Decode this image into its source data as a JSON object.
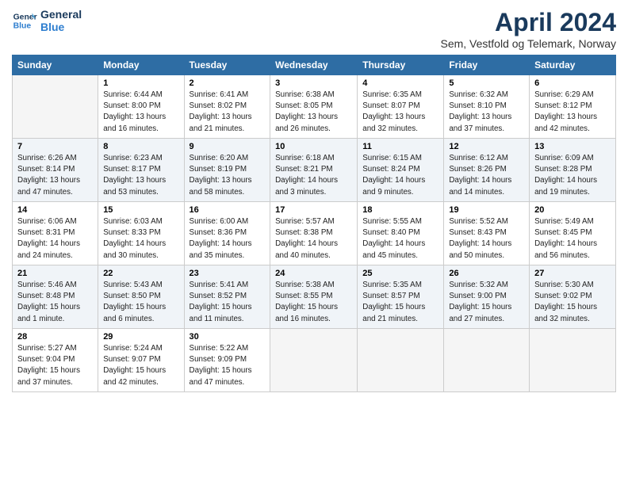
{
  "header": {
    "logo_line1": "General",
    "logo_line2": "Blue",
    "title": "April 2024",
    "subtitle": "Sem, Vestfold og Telemark, Norway"
  },
  "weekdays": [
    "Sunday",
    "Monday",
    "Tuesday",
    "Wednesday",
    "Thursday",
    "Friday",
    "Saturday"
  ],
  "weeks": [
    [
      {
        "day": "",
        "info": ""
      },
      {
        "day": "1",
        "info": "Sunrise: 6:44 AM\nSunset: 8:00 PM\nDaylight: 13 hours\nand 16 minutes."
      },
      {
        "day": "2",
        "info": "Sunrise: 6:41 AM\nSunset: 8:02 PM\nDaylight: 13 hours\nand 21 minutes."
      },
      {
        "day": "3",
        "info": "Sunrise: 6:38 AM\nSunset: 8:05 PM\nDaylight: 13 hours\nand 26 minutes."
      },
      {
        "day": "4",
        "info": "Sunrise: 6:35 AM\nSunset: 8:07 PM\nDaylight: 13 hours\nand 32 minutes."
      },
      {
        "day": "5",
        "info": "Sunrise: 6:32 AM\nSunset: 8:10 PM\nDaylight: 13 hours\nand 37 minutes."
      },
      {
        "day": "6",
        "info": "Sunrise: 6:29 AM\nSunset: 8:12 PM\nDaylight: 13 hours\nand 42 minutes."
      }
    ],
    [
      {
        "day": "7",
        "info": "Sunrise: 6:26 AM\nSunset: 8:14 PM\nDaylight: 13 hours\nand 47 minutes."
      },
      {
        "day": "8",
        "info": "Sunrise: 6:23 AM\nSunset: 8:17 PM\nDaylight: 13 hours\nand 53 minutes."
      },
      {
        "day": "9",
        "info": "Sunrise: 6:20 AM\nSunset: 8:19 PM\nDaylight: 13 hours\nand 58 minutes."
      },
      {
        "day": "10",
        "info": "Sunrise: 6:18 AM\nSunset: 8:21 PM\nDaylight: 14 hours\nand 3 minutes."
      },
      {
        "day": "11",
        "info": "Sunrise: 6:15 AM\nSunset: 8:24 PM\nDaylight: 14 hours\nand 9 minutes."
      },
      {
        "day": "12",
        "info": "Sunrise: 6:12 AM\nSunset: 8:26 PM\nDaylight: 14 hours\nand 14 minutes."
      },
      {
        "day": "13",
        "info": "Sunrise: 6:09 AM\nSunset: 8:28 PM\nDaylight: 14 hours\nand 19 minutes."
      }
    ],
    [
      {
        "day": "14",
        "info": "Sunrise: 6:06 AM\nSunset: 8:31 PM\nDaylight: 14 hours\nand 24 minutes."
      },
      {
        "day": "15",
        "info": "Sunrise: 6:03 AM\nSunset: 8:33 PM\nDaylight: 14 hours\nand 30 minutes."
      },
      {
        "day": "16",
        "info": "Sunrise: 6:00 AM\nSunset: 8:36 PM\nDaylight: 14 hours\nand 35 minutes."
      },
      {
        "day": "17",
        "info": "Sunrise: 5:57 AM\nSunset: 8:38 PM\nDaylight: 14 hours\nand 40 minutes."
      },
      {
        "day": "18",
        "info": "Sunrise: 5:55 AM\nSunset: 8:40 PM\nDaylight: 14 hours\nand 45 minutes."
      },
      {
        "day": "19",
        "info": "Sunrise: 5:52 AM\nSunset: 8:43 PM\nDaylight: 14 hours\nand 50 minutes."
      },
      {
        "day": "20",
        "info": "Sunrise: 5:49 AM\nSunset: 8:45 PM\nDaylight: 14 hours\nand 56 minutes."
      }
    ],
    [
      {
        "day": "21",
        "info": "Sunrise: 5:46 AM\nSunset: 8:48 PM\nDaylight: 15 hours\nand 1 minute."
      },
      {
        "day": "22",
        "info": "Sunrise: 5:43 AM\nSunset: 8:50 PM\nDaylight: 15 hours\nand 6 minutes."
      },
      {
        "day": "23",
        "info": "Sunrise: 5:41 AM\nSunset: 8:52 PM\nDaylight: 15 hours\nand 11 minutes."
      },
      {
        "day": "24",
        "info": "Sunrise: 5:38 AM\nSunset: 8:55 PM\nDaylight: 15 hours\nand 16 minutes."
      },
      {
        "day": "25",
        "info": "Sunrise: 5:35 AM\nSunset: 8:57 PM\nDaylight: 15 hours\nand 21 minutes."
      },
      {
        "day": "26",
        "info": "Sunrise: 5:32 AM\nSunset: 9:00 PM\nDaylight: 15 hours\nand 27 minutes."
      },
      {
        "day": "27",
        "info": "Sunrise: 5:30 AM\nSunset: 9:02 PM\nDaylight: 15 hours\nand 32 minutes."
      }
    ],
    [
      {
        "day": "28",
        "info": "Sunrise: 5:27 AM\nSunset: 9:04 PM\nDaylight: 15 hours\nand 37 minutes."
      },
      {
        "day": "29",
        "info": "Sunrise: 5:24 AM\nSunset: 9:07 PM\nDaylight: 15 hours\nand 42 minutes."
      },
      {
        "day": "30",
        "info": "Sunrise: 5:22 AM\nSunset: 9:09 PM\nDaylight: 15 hours\nand 47 minutes."
      },
      {
        "day": "",
        "info": ""
      },
      {
        "day": "",
        "info": ""
      },
      {
        "day": "",
        "info": ""
      },
      {
        "day": "",
        "info": ""
      }
    ]
  ]
}
